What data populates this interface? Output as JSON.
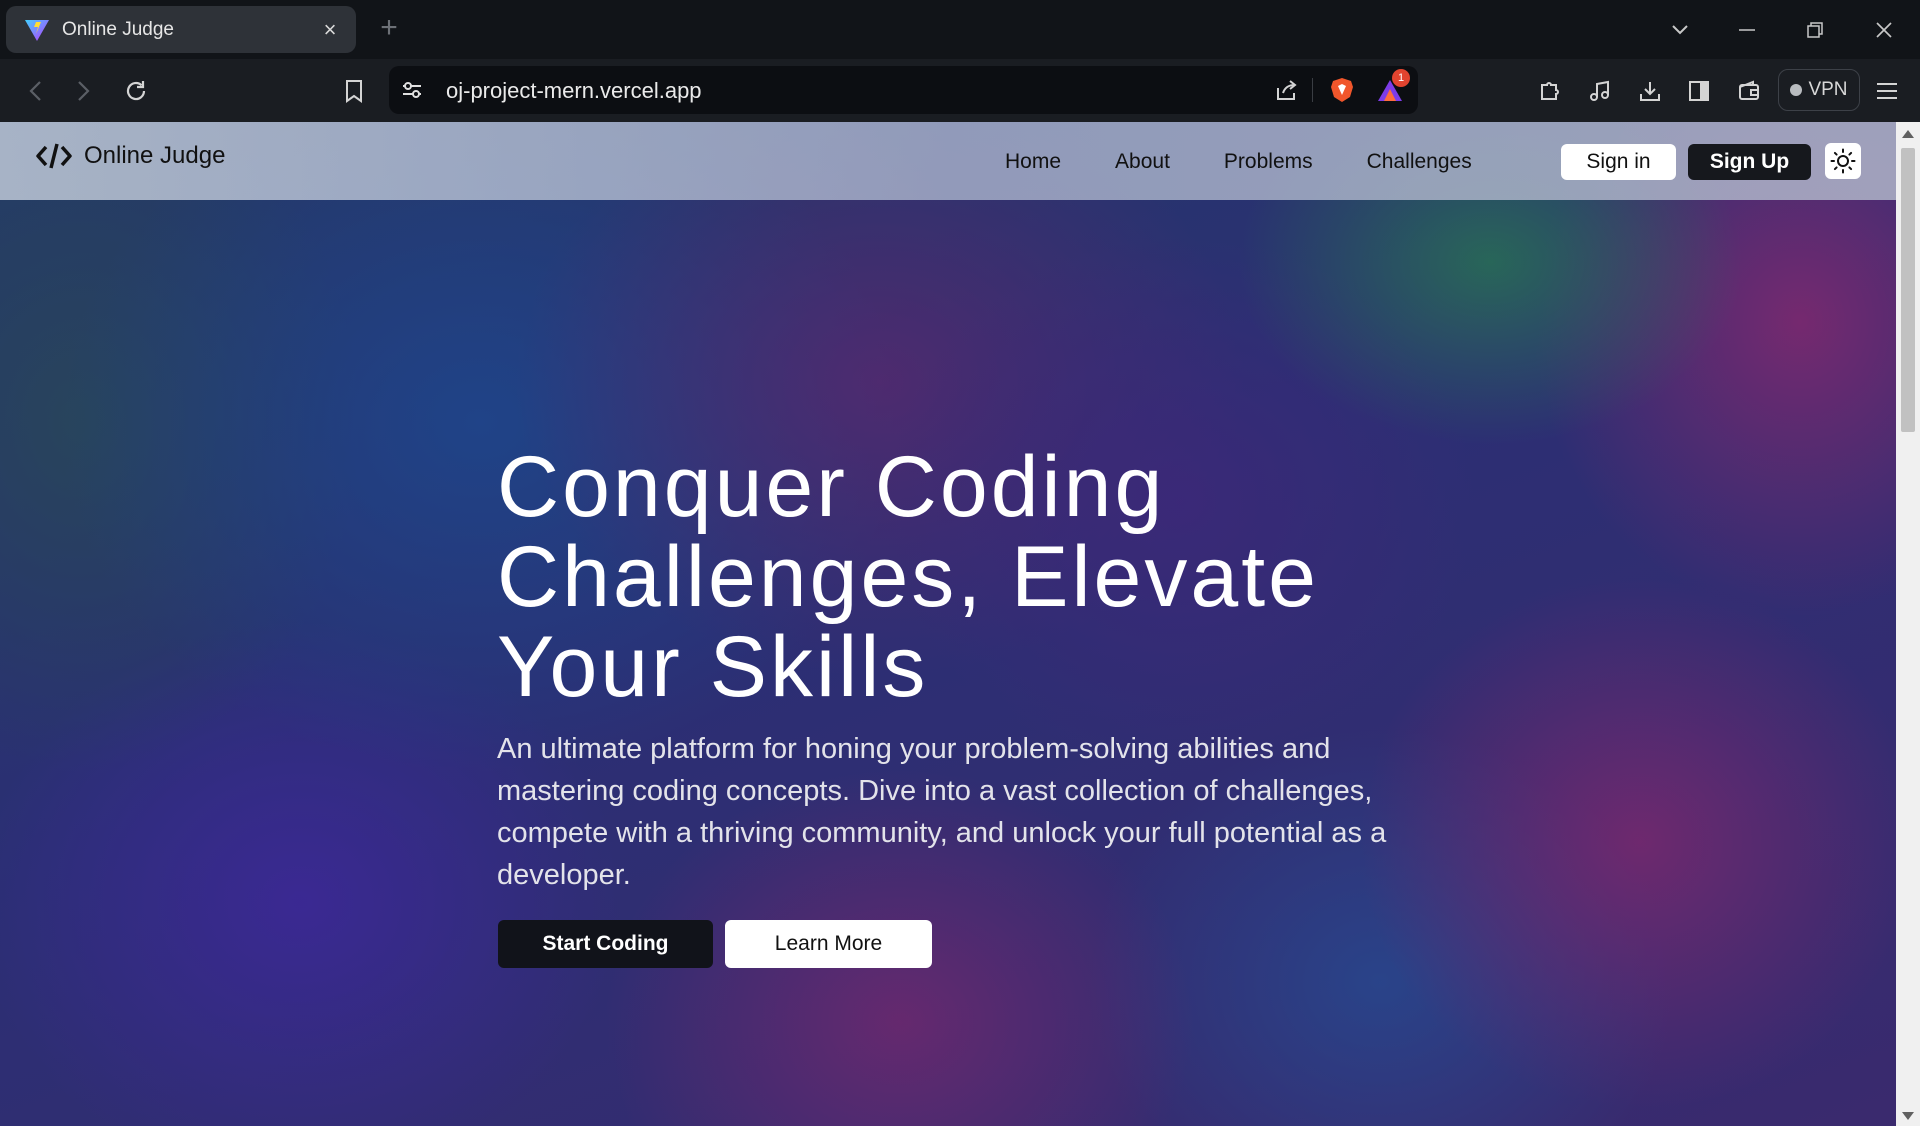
{
  "browser": {
    "tab_title": "Online Judge",
    "tab_close_glyph": "×",
    "new_tab_glyph": "+",
    "url": "oj-project-mern.vercel.app",
    "vpn_label": "VPN",
    "notification_count": "1"
  },
  "site": {
    "brand": "Online Judge",
    "nav": [
      "Home",
      "About",
      "Problems",
      "Challenges"
    ],
    "signin_label": "Sign in",
    "signup_label": "Sign Up"
  },
  "hero": {
    "title_lines": [
      "Conquer Coding",
      "Challenges, Elevate",
      "Your Skills"
    ],
    "description": "An ultimate platform for honing your problem-solving abilities and mastering coding concepts. Dive into a vast collection of challenges, compete with a thriving community, and unlock your full potential as a developer.",
    "primary_cta": "Start Coding",
    "secondary_cta": "Learn More"
  },
  "icons": {
    "favicon": "vite-logo-icon",
    "brand_icon": "code-icon",
    "theme_toggle": "sun-icon"
  },
  "colors": {
    "signup_bg": "#16181d",
    "start_bg": "#11131a",
    "brave_badge": "#e2442f"
  }
}
